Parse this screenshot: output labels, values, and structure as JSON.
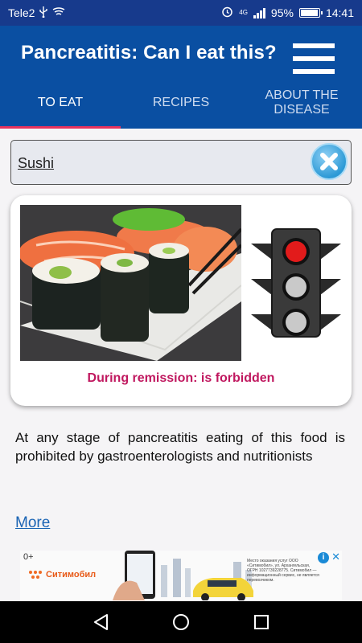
{
  "status_bar": {
    "carrier": "Tele2",
    "network": "4G",
    "battery_percent": "95%",
    "battery_level": 0.95,
    "time": "14:41",
    "icons": [
      "usb-icon",
      "cast-icon",
      "alarm-icon",
      "signal-icon",
      "battery-icon"
    ]
  },
  "app_bar": {
    "title": "Pancreatitis: Can I eat this?",
    "menu_icon": "hamburger-menu-icon",
    "tabs": [
      {
        "label": "TO EAT",
        "active": true
      },
      {
        "label": "RECIPES",
        "active": false
      },
      {
        "label": "ABOUT THE\nDISEASE",
        "active": false
      }
    ]
  },
  "search": {
    "value": "Sushi",
    "clear_icon": "clear-x-icon"
  },
  "food_card": {
    "image": "sushi-rolls-photo",
    "traffic_light": "red",
    "verdict": "During remission: is forbidden"
  },
  "description": "At any stage of pancreatitis eating of this food is prohibited by gastroenterologists and nutritionists",
  "more_link": "More",
  "ad": {
    "age_label": "0+",
    "brand": "Ситимобил",
    "small_print": "Место оказания услуг ООО «Ситимобил», ул. Архангельская, ОГРН 1027739228775. Ситимобил — информационный сервис, не является перевозчиком.",
    "info_label": "i",
    "close_label": "✕"
  },
  "colors": {
    "status_bar": "#173a8c",
    "app_bar": "#0a4fa2",
    "tab_indicator": "#e8335e",
    "verdict": "#c0185f",
    "link": "#1a64b4"
  }
}
